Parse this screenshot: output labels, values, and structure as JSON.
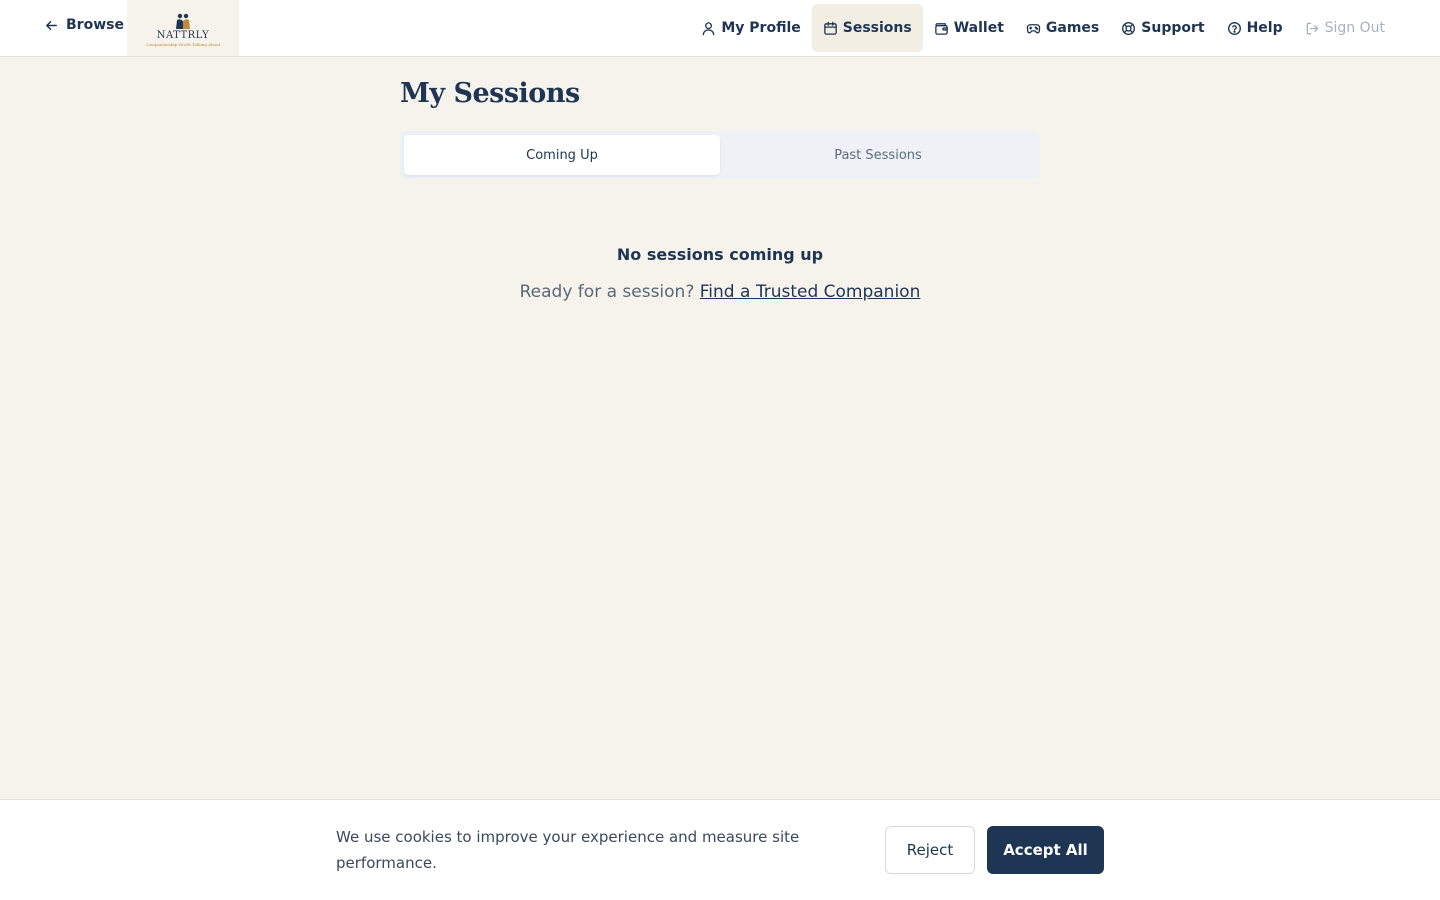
{
  "header": {
    "back_label": "Browse",
    "logo": {
      "name": "NATTRLY",
      "tagline": "Companionship Worth Talking About"
    },
    "nav": {
      "profile": "My Profile",
      "sessions": "Sessions",
      "wallet": "Wallet",
      "games": "Games",
      "support": "Support",
      "help": "Help",
      "signout": "Sign Out"
    },
    "active_item": "Sessions"
  },
  "main": {
    "title": "My Sessions",
    "tabs": {
      "coming_up": "Coming Up",
      "past": "Past Sessions"
    },
    "active_tab": "Coming Up",
    "empty": {
      "title": "No sessions coming up",
      "prompt": "Ready for a session?",
      "link": "Find a Trusted Companion"
    }
  },
  "cookie_banner": {
    "text": "We use cookies to improve your experience and measure site performance.",
    "reject": "Reject",
    "accept": "Accept All"
  },
  "colors": {
    "primary": "#1e3553",
    "background": "#f6f3ec",
    "active_nav_bg": "#f3eee4",
    "accent": "#c08a3e"
  },
  "icons": {
    "back": "arrow-left-icon",
    "profile": "user-icon",
    "sessions": "calendar-icon",
    "wallet": "wallet-icon",
    "games": "gamepad-icon",
    "support": "lifebuoy-icon",
    "help": "help-circle-icon",
    "signout": "sign-out-icon"
  }
}
